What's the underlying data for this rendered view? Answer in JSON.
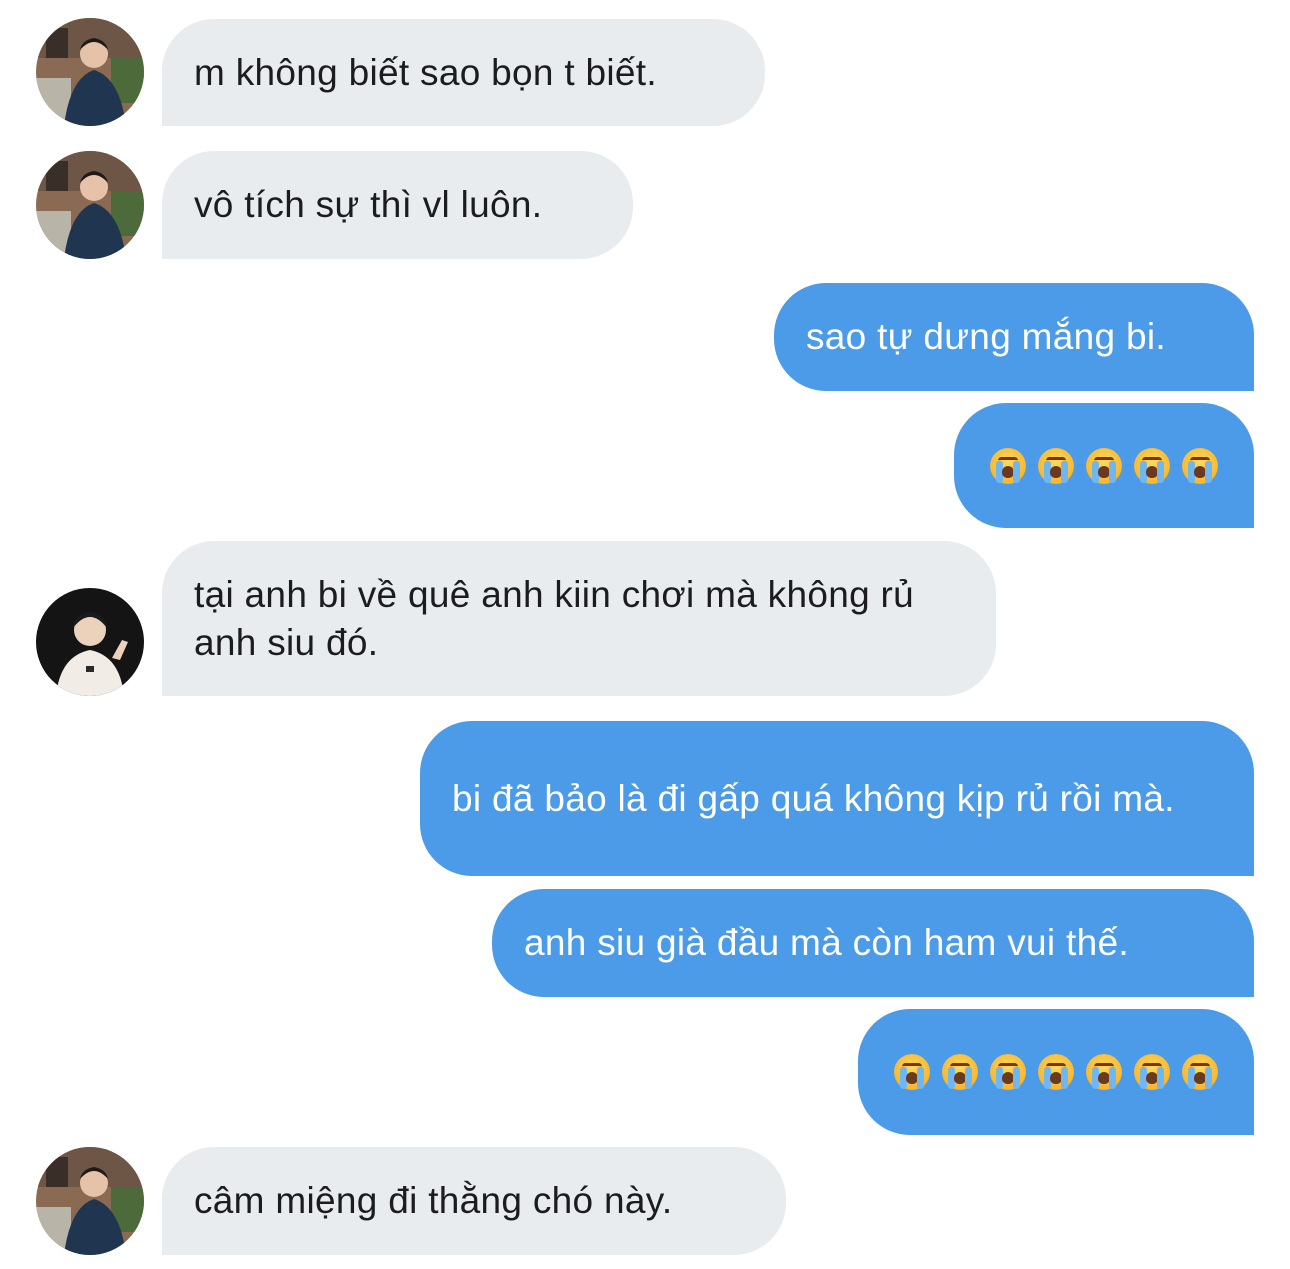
{
  "messages": [
    {
      "side": "in",
      "avatar": "street",
      "text": "m không biết sao bọn t biết."
    },
    {
      "side": "in",
      "avatar": "street",
      "text": "vô tích sự thì vl luôn."
    },
    {
      "side": "out",
      "text": "sao tự dưng mắng bi."
    },
    {
      "side": "out",
      "emoji": "loudly-crying-face",
      "emoji_count": 5
    },
    {
      "side": "in",
      "avatar": "studio",
      "text": "tại anh bi về quê anh kiin chơi mà không rủ anh siu đó."
    },
    {
      "side": "out",
      "text": "bi đã bảo là đi gấp quá không kịp rủ rồi mà."
    },
    {
      "side": "out",
      "text": "anh siu già đầu mà còn ham vui thế."
    },
    {
      "side": "out",
      "emoji": "loudly-crying-face",
      "emoji_count": 7
    },
    {
      "side": "in",
      "avatar": "street",
      "text": "câm miệng đi thằng chó này."
    }
  ],
  "colors": {
    "incoming_bubble": "#e8ecef",
    "outgoing_bubble": "#4b9be8",
    "incoming_text": "#1c1c1e",
    "outgoing_text": "#ffffff"
  }
}
